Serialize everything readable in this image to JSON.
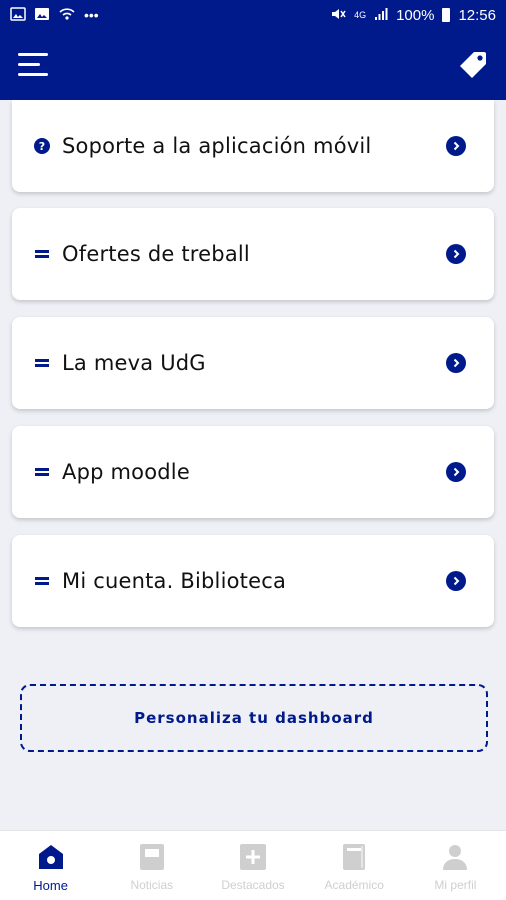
{
  "status_bar": {
    "battery_percent": "100%",
    "time": "12:56",
    "network": "4G",
    "overflow": "•••"
  },
  "cards": [
    {
      "label": "Soporte a la aplicación móvil",
      "icon": "question-circle-icon"
    },
    {
      "label": "Ofertes de treball",
      "icon": "bars-icon"
    },
    {
      "label": "La meva UdG",
      "icon": "bars-icon"
    },
    {
      "label": "App moodle",
      "icon": "bars-icon"
    },
    {
      "label": "Mi cuenta. Biblioteca",
      "icon": "bars-icon"
    }
  ],
  "dashboard_button": {
    "label": "Personaliza tu dashboard"
  },
  "bottom_nav": [
    {
      "label": "Home",
      "icon": "home-icon",
      "active": true
    },
    {
      "label": "Noticias",
      "icon": "news-icon",
      "active": false
    },
    {
      "label": "Destacados",
      "icon": "plus-square-icon",
      "active": false
    },
    {
      "label": "Académico",
      "icon": "book-icon",
      "active": false
    },
    {
      "label": "Mi perfil",
      "icon": "user-icon",
      "active": false
    }
  ],
  "colors": {
    "primary": "#001a8c",
    "background": "#eef0f5",
    "inactive": "#cfcfcf"
  }
}
